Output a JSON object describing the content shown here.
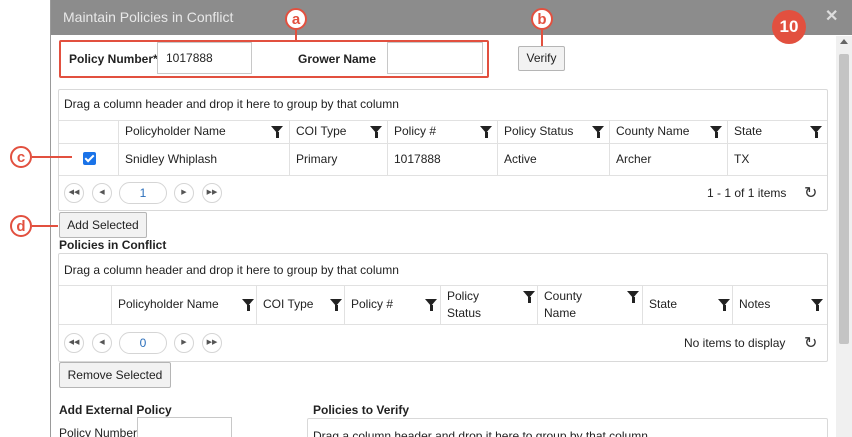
{
  "dialog": {
    "title": "Maintain Policies in Conflict",
    "close_glyph": "✕",
    "step_badge": "10"
  },
  "search": {
    "policy_number_label": "Policy Number*",
    "policy_number_value": "1017888",
    "grower_name_label": "Grower Name",
    "grower_name_value": "",
    "verify_label": "Verify"
  },
  "callouts": {
    "a": "a",
    "b": "b",
    "c": "c",
    "d": "d",
    "color": "#e2503f"
  },
  "grid1": {
    "group_hint": "Drag a column header and drop it here to group by that column",
    "columns": [
      "Policyholder Name",
      "COI Type",
      "Policy #",
      "Policy Status",
      "County Name",
      "State"
    ],
    "rows": [
      {
        "checked": true,
        "cells": [
          "Snidley Whiplash",
          "Primary",
          "1017888",
          "Active",
          "Archer",
          "TX"
        ]
      }
    ],
    "page": "1",
    "pager_info": "1 - 1 of 1 items"
  },
  "add_selected_label": "Add Selected",
  "conflict": {
    "heading": "Policies in Conflict",
    "group_hint": "Drag a column header and drop it here to group by that column",
    "columns": [
      "Policyholder Name",
      "COI Type",
      "Policy #",
      "Policy\nStatus",
      "County\nName",
      "State",
      "Notes"
    ],
    "page": "0",
    "pager_info": "No items to display"
  },
  "remove_selected_label": "Remove Selected",
  "external": {
    "heading": "Add External Policy",
    "policy_number_label": "Policy Number"
  },
  "verify_section": {
    "heading": "Policies to Verify",
    "group_hint": "Drag a column header and drop it here to group by that column"
  },
  "icons": {
    "first": "first-page-icon",
    "prev": "prev-page-icon",
    "next": "next-page-icon",
    "last": "last-page-icon",
    "refresh": "refresh-icon",
    "filter": "filter-icon"
  }
}
